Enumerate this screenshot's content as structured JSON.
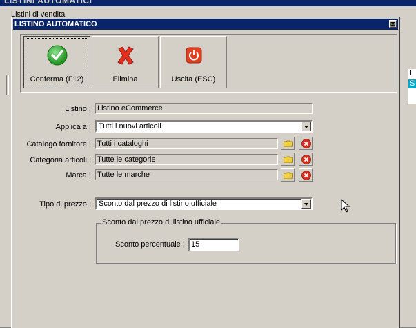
{
  "background_window": {
    "title": "LISTINI AUTOMATICI",
    "subtitle": "Listini di vendita",
    "right_panel": {
      "header": "L",
      "selected": "S"
    }
  },
  "dialog": {
    "title": "LISTINO AUTOMATICO",
    "close_symbol": "⊠",
    "toolbar": {
      "confirm_label": "Conferma (F12)",
      "delete_label": "Elimina",
      "exit_label": "Uscita (ESC)"
    },
    "form": {
      "listino": {
        "label": "Listino :",
        "value": "Listino eCommerce"
      },
      "applica_a": {
        "label": "Applica a :",
        "value": "Tutti i nuovi articoli"
      },
      "catalogo_fornitore": {
        "label": "Catalogo fornitore :",
        "value": "Tutti i cataloghi"
      },
      "categoria_articoli": {
        "label": "Categoria articoli :",
        "value": "Tutte le categorie"
      },
      "marca": {
        "label": "Marca :",
        "value": "Tutte le marche"
      },
      "tipo_di_prezzo": {
        "label": "Tipo di prezzo :",
        "value": "Sconto dal prezzo di listino ufficiale"
      }
    },
    "group": {
      "title": "Sconto dal prezzo di listino ufficiale",
      "sconto_label": "Sconto percentuale :",
      "sconto_value": "15"
    }
  },
  "colors": {
    "title_bar": "#0a246a",
    "face": "#d4d0c8",
    "confirm_icon": "#2aa52a",
    "delete_icon": "#e0301e",
    "exit_icon": "#e04020"
  },
  "icons": [
    "check-icon",
    "x-mark-icon",
    "power-icon",
    "folder-icon",
    "clear-icon",
    "dropdown-arrow-icon",
    "mouse-cursor-icon"
  ]
}
